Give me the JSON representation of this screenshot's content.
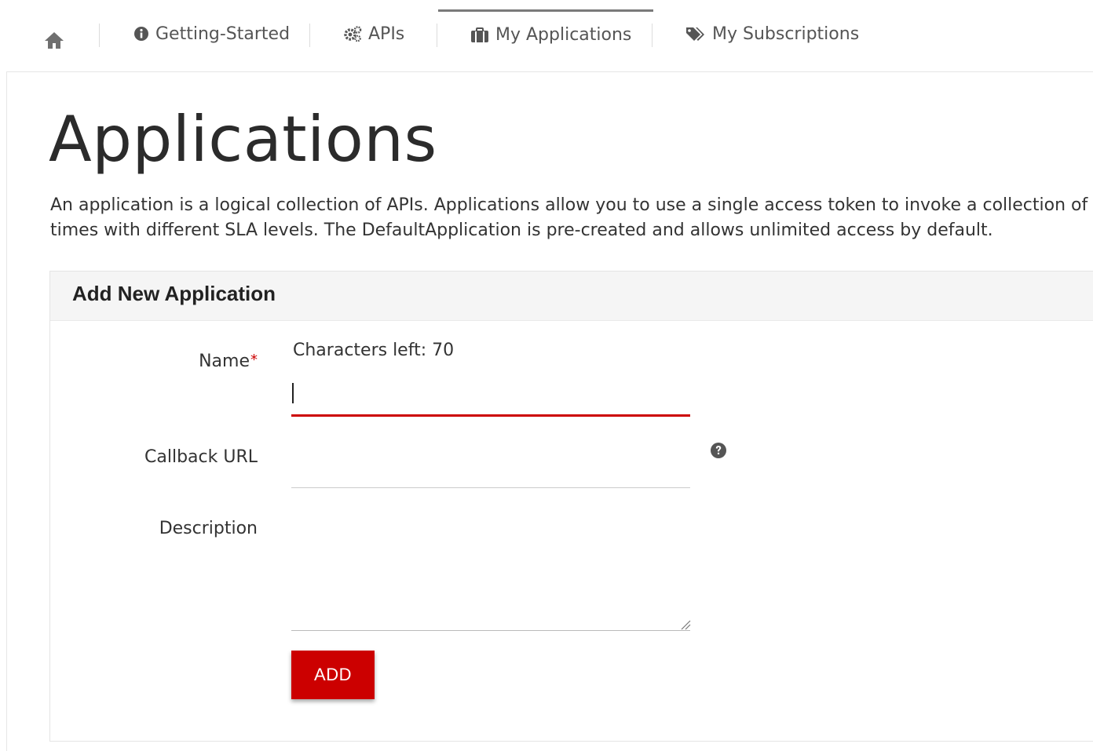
{
  "nav": {
    "home_icon": "home-icon",
    "items": [
      {
        "label": "Getting-Started",
        "icon": "info-circle-icon",
        "active": false
      },
      {
        "label": "APIs",
        "icon": "cogs-icon",
        "active": false
      },
      {
        "label": "My Applications",
        "icon": "briefcase-icon",
        "active": true
      },
      {
        "label": "My Subscriptions",
        "icon": "tags-icon",
        "active": false
      }
    ]
  },
  "page": {
    "title": "Applications",
    "description": "An application is a logical collection of APIs. Applications allow you to use a single access token to invoke a collection of APIs and",
    "description_line2": "times with different SLA levels. The DefaultApplication is pre-created and allows unlimited access by default."
  },
  "panel": {
    "title": "Add New Application",
    "chars_left": "Characters left: 70",
    "fields": {
      "name_label": "Name",
      "name_required_mark": "*",
      "name_value": "",
      "callback_label": "Callback URL",
      "callback_value": "",
      "description_label": "Description",
      "description_value": ""
    },
    "add_button": "ADD"
  },
  "colors": {
    "accent": "#cc0000",
    "active_tab_border": "#7a7a7a",
    "panel_header_bg": "#f5f5f5"
  }
}
